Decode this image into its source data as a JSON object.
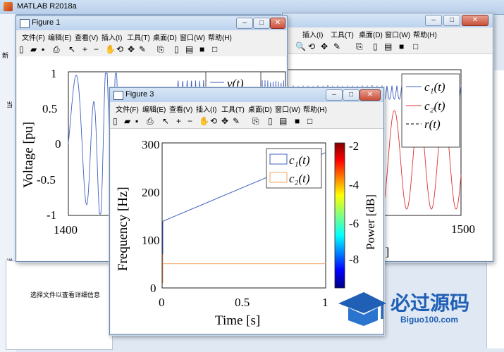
{
  "app": {
    "title": "MATLAB R2018a"
  },
  "main": {
    "bottom_text": "选择文件以查看详细信息",
    "side_label_1": "新",
    "side_label_2": "当",
    "side_label_3": "详"
  },
  "menu": [
    "文件(F)",
    "编辑(E)",
    "查看(V)",
    "插入(I)",
    "工具(T)",
    "桌面(D)",
    "窗口(W)",
    "帮助(H)"
  ],
  "figure1": {
    "title": "Figure 1",
    "ylabel": "Voltage [pu]",
    "yticks": [
      "1",
      "0.5",
      "0",
      "-0.5",
      "-1"
    ],
    "xticks": [
      "1400"
    ],
    "legend": "v(t)"
  },
  "figure2": {
    "xticks": [
      "1500"
    ],
    "legend": [
      "c₁(t)",
      "c₂(t)",
      "r(t)"
    ],
    "xlabel_fragment": "s]"
  },
  "figure3": {
    "title": "Figure 3",
    "xlabel": "Time [s]",
    "ylabel": "Frequency [Hz]",
    "xticks": [
      "0",
      "0.5",
      "1"
    ],
    "yticks": [
      "300",
      "200",
      "100",
      "0"
    ],
    "legend": [
      "c₁(t)",
      "c₂(t)"
    ],
    "colorbar_label": "Power [dB]",
    "colorbar_ticks": [
      "-2",
      "-4",
      "-6",
      "-8"
    ]
  },
  "watermark": {
    "text": "必过源码",
    "sub": "Biguo100.com"
  },
  "colors": {
    "c1": "#4060c0",
    "c2": "#f0a060",
    "r": "#000000",
    "c2_fig2": "#e03030"
  }
}
